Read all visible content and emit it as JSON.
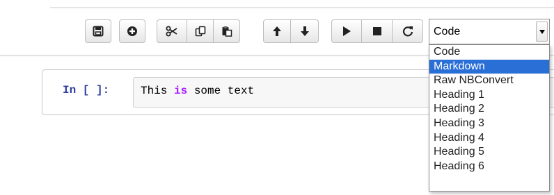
{
  "toolbar": {
    "buttons": [
      {
        "name": "save-button",
        "icon": "save-icon"
      },
      {
        "name": "insert-cell-button",
        "icon": "plus-circle-icon"
      },
      {
        "name": "cut-button",
        "icon": "scissors-icon"
      },
      {
        "name": "copy-button",
        "icon": "copy-icon"
      },
      {
        "name": "paste-button",
        "icon": "paste-icon"
      },
      {
        "name": "move-up-button",
        "icon": "arrow-up-icon"
      },
      {
        "name": "move-down-button",
        "icon": "arrow-down-icon"
      },
      {
        "name": "run-button",
        "icon": "play-icon"
      },
      {
        "name": "interrupt-button",
        "icon": "stop-icon"
      },
      {
        "name": "restart-button",
        "icon": "restart-icon"
      }
    ],
    "cell_type_select": {
      "value": "Code",
      "options": [
        "Code",
        "Markdown",
        "Raw NBConvert",
        "Heading 1",
        "Heading 2",
        "Heading 3",
        "Heading 4",
        "Heading 5",
        "Heading 6"
      ],
      "highlighted": "Markdown"
    }
  },
  "cell": {
    "prompt": "In [ ]:",
    "code_before": "This ",
    "code_keyword": "is",
    "code_after": " some text"
  },
  "colors": {
    "prompt": "#303f9f",
    "keyword": "#aa22ff",
    "selected_option_bg": "#2a6fd6"
  }
}
